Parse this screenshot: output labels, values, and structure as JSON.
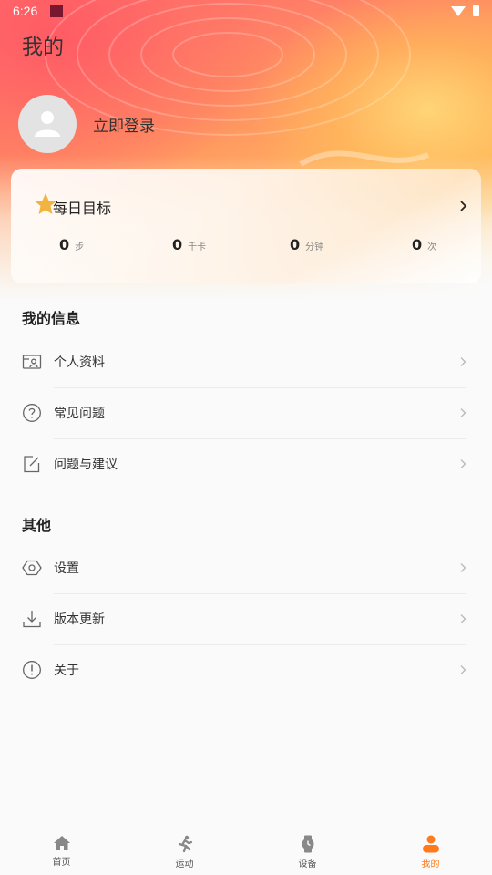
{
  "status_bar": {
    "time": "6:26"
  },
  "header": {
    "title": "我的"
  },
  "profile": {
    "login_label": "立即登录"
  },
  "daily_goal": {
    "title": "每日目标",
    "stats": [
      {
        "value": "0",
        "unit": "步"
      },
      {
        "value": "0",
        "unit": "千卡"
      },
      {
        "value": "0",
        "unit": "分钟"
      },
      {
        "value": "0",
        "unit": "次"
      }
    ]
  },
  "my_info": {
    "title": "我的信息",
    "items": [
      {
        "label": "个人资料",
        "icon": "profile-card-icon"
      },
      {
        "label": "常见问题",
        "icon": "question-icon"
      },
      {
        "label": "问题与建议",
        "icon": "edit-icon"
      }
    ]
  },
  "other": {
    "title": "其他",
    "items": [
      {
        "label": "设置",
        "icon": "settings-icon"
      },
      {
        "label": "版本更新",
        "icon": "download-icon"
      },
      {
        "label": "关于",
        "icon": "info-icon"
      }
    ]
  },
  "tabs": [
    {
      "label": "首页",
      "icon": "home-icon"
    },
    {
      "label": "运动",
      "icon": "running-icon"
    },
    {
      "label": "设备",
      "icon": "watch-icon"
    },
    {
      "label": "我的",
      "icon": "person-icon",
      "active": true
    }
  ],
  "colors": {
    "accent": "#ff7a1a",
    "text": "#333333",
    "muted": "#888888"
  }
}
